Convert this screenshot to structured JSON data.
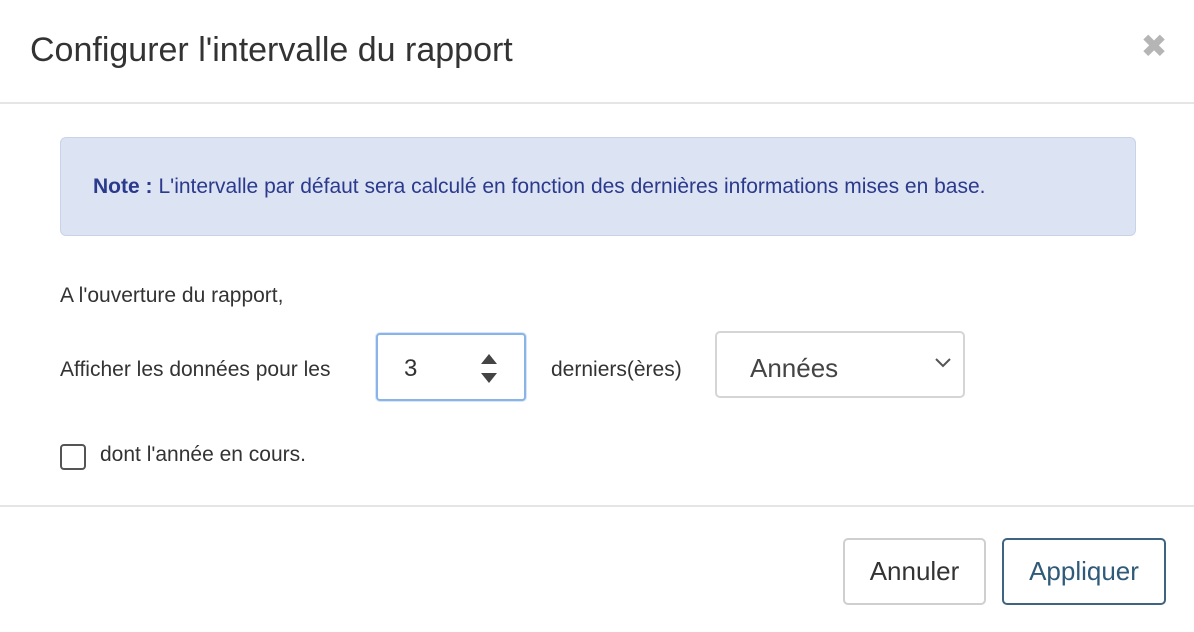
{
  "dialog": {
    "title": "Configurer l'intervalle du rapport",
    "close_symbol": "✖"
  },
  "note": {
    "label": "Note :",
    "text": "L'intervalle par défaut sera calculé en fonction des dernières informations mises en base."
  },
  "form": {
    "intro": "A l'ouverture du rapport,",
    "display_label": "Afficher les données pour les",
    "count_value": "3",
    "suffix": "derniers(ères)",
    "period_selected": "Années",
    "include_current_label": "dont l'année en cours.",
    "include_current_checked": false
  },
  "footer": {
    "cancel_label": "Annuler",
    "apply_label": "Appliquer"
  },
  "colors": {
    "note_background": "#dce3f2",
    "note_text": "#2b3a8c",
    "focus_border": "#8ab4e8",
    "apply_border": "#3f6482"
  },
  "icons": {
    "close": "close-icon",
    "spinner_up": "spinner-up-icon",
    "spinner_down": "spinner-down-icon",
    "dropdown": "chevron-down-icon"
  }
}
